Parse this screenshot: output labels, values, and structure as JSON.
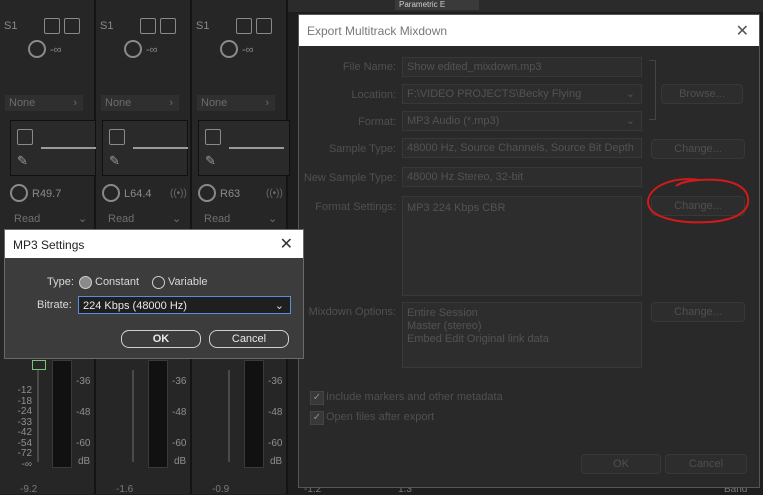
{
  "mixer": {
    "top_tabs": {
      "parametric": "Parametric E"
    },
    "strips": [
      {
        "name": "S1",
        "knob_value": "-∞",
        "send": "None",
        "pan": "R49.7",
        "mode": "Read",
        "bottom": "-9.2"
      },
      {
        "name": "S1",
        "knob_value": "-∞",
        "send": "None",
        "pan": "L64.4",
        "mode": "Read",
        "bottom": "-1.6"
      },
      {
        "name": "S1",
        "knob_value": "-∞",
        "send": "None",
        "pan": "R63",
        "mode": "Read",
        "bottom": "-0.9"
      }
    ],
    "fader_scale": [
      "-12",
      "-18",
      "-24",
      "-33",
      "-42",
      "-54",
      "-72",
      "-∞"
    ],
    "meter_scale": [
      "-36",
      "-48",
      "-60",
      "dB"
    ],
    "bottom_extra": [
      "-1.2",
      "1.3",
      "Band"
    ]
  },
  "export_dialog": {
    "title": "Export Multitrack Mixdown",
    "close_glyph": "✕",
    "file_name_label": "File Name:",
    "file_name_value": "Show edited_mixdown.mp3",
    "location_label": "Location:",
    "location_value": "F:\\VIDEO PROJECTS\\Becky Flying",
    "browse_label": "Browse...",
    "format_label": "Format:",
    "format_value": "MP3 Audio (*.mp3)",
    "sample_type_label": "Sample Type:",
    "sample_type_value": "48000 Hz, Source Channels, Source Bit Depth",
    "change_label": "Change...",
    "new_sample_type_label": "New Sample Type:",
    "new_sample_type_value": "48000 Hz Stereo, 32-bit",
    "format_settings_label": "Format Settings:",
    "format_settings_value": "MP3 224 Kbps CBR",
    "mixdown_options_label": "Mixdown Options:",
    "mixdown_options_lines": [
      "Entire Session",
      "Master (stereo)",
      "Embed Edit Original link data"
    ],
    "include_markers_label": "Include markers and other metadata",
    "open_files_label": "Open files after export",
    "ok_label": "OK",
    "cancel_label": "Cancel",
    "checkmark": "✓"
  },
  "mp3_dialog": {
    "title": "MP3 Settings",
    "close_glyph": "✕",
    "type_label": "Type:",
    "constant_label": "Constant",
    "variable_label": "Variable",
    "bitrate_label": "Bitrate:",
    "bitrate_value": "224 Kbps (48000 Hz)",
    "ok_label": "OK",
    "cancel_label": "Cancel",
    "selected_type": "Constant"
  },
  "colors": {
    "accent_focus": "#5a8ed6",
    "annotation": "#d11a1a"
  }
}
